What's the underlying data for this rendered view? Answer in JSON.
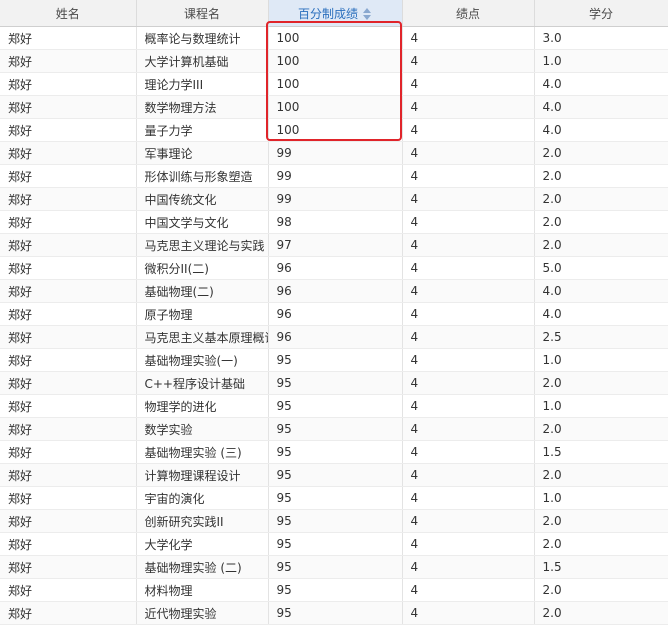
{
  "table": {
    "headers": {
      "name": "姓名",
      "course": "课程名",
      "score": "百分制成绩",
      "gpa": "绩点",
      "credit": "学分"
    },
    "rows": [
      {
        "name": "郑好",
        "course": "概率论与数理统计",
        "score": "100",
        "gpa": "4",
        "credit": "3.0"
      },
      {
        "name": "郑好",
        "course": "大学计算机基础",
        "score": "100",
        "gpa": "4",
        "credit": "1.0"
      },
      {
        "name": "郑好",
        "course": "理论力学III",
        "score": "100",
        "gpa": "4",
        "credit": "4.0"
      },
      {
        "name": "郑好",
        "course": "数学物理方法",
        "score": "100",
        "gpa": "4",
        "credit": "4.0"
      },
      {
        "name": "郑好",
        "course": "量子力学",
        "score": "100",
        "gpa": "4",
        "credit": "4.0"
      },
      {
        "name": "郑好",
        "course": "军事理论",
        "score": "99",
        "gpa": "4",
        "credit": "2.0"
      },
      {
        "name": "郑好",
        "course": "形体训练与形象塑造",
        "score": "99",
        "gpa": "4",
        "credit": "2.0"
      },
      {
        "name": "郑好",
        "course": "中国传统文化",
        "score": "99",
        "gpa": "4",
        "credit": "2.0"
      },
      {
        "name": "郑好",
        "course": "中国文学与文化",
        "score": "98",
        "gpa": "4",
        "credit": "2.0"
      },
      {
        "name": "郑好",
        "course": "马克思主义理论与实践",
        "score": "97",
        "gpa": "4",
        "credit": "2.0"
      },
      {
        "name": "郑好",
        "course": "微积分II(二)",
        "score": "96",
        "gpa": "4",
        "credit": "5.0"
      },
      {
        "name": "郑好",
        "course": "基础物理(二)",
        "score": "96",
        "gpa": "4",
        "credit": "4.0"
      },
      {
        "name": "郑好",
        "course": "原子物理",
        "score": "96",
        "gpa": "4",
        "credit": "4.0"
      },
      {
        "name": "郑好",
        "course": "马克思主义基本原理概论",
        "score": "96",
        "gpa": "4",
        "credit": "2.5"
      },
      {
        "name": "郑好",
        "course": "基础物理实验(一)",
        "score": "95",
        "gpa": "4",
        "credit": "1.0"
      },
      {
        "name": "郑好",
        "course": "C++程序设计基础",
        "score": "95",
        "gpa": "4",
        "credit": "2.0"
      },
      {
        "name": "郑好",
        "course": "物理学的进化",
        "score": "95",
        "gpa": "4",
        "credit": "1.0"
      },
      {
        "name": "郑好",
        "course": "数学实验",
        "score": "95",
        "gpa": "4",
        "credit": "2.0"
      },
      {
        "name": "郑好",
        "course": "基础物理实验 (三)",
        "score": "95",
        "gpa": "4",
        "credit": "1.5"
      },
      {
        "name": "郑好",
        "course": "计算物理课程设计",
        "score": "95",
        "gpa": "4",
        "credit": "2.0"
      },
      {
        "name": "郑好",
        "course": "宇宙的演化",
        "score": "95",
        "gpa": "4",
        "credit": "1.0"
      },
      {
        "name": "郑好",
        "course": "创新研究实践II",
        "score": "95",
        "gpa": "4",
        "credit": "2.0"
      },
      {
        "name": "郑好",
        "course": "大学化学",
        "score": "95",
        "gpa": "4",
        "credit": "2.0"
      },
      {
        "name": "郑好",
        "course": "基础物理实验 (二)",
        "score": "95",
        "gpa": "4",
        "credit": "1.5"
      },
      {
        "name": "郑好",
        "course": "材料物理",
        "score": "95",
        "gpa": "4",
        "credit": "2.0"
      },
      {
        "name": "郑好",
        "course": "近代物理实验",
        "score": "95",
        "gpa": "4",
        "credit": "2.0"
      }
    ]
  },
  "colors": {
    "highlight": "#e0242a",
    "sorted_header": "#2a6fbd"
  },
  "icons": {
    "sort": "sort-icon"
  }
}
